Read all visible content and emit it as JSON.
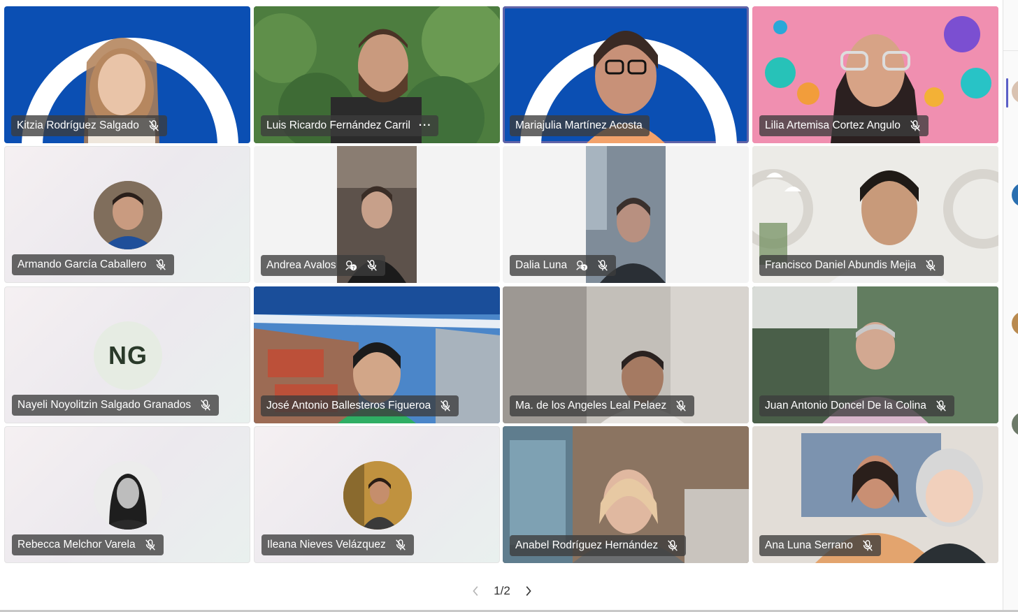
{
  "participants": [
    {
      "name": "Kitzia Rodríguez Salgado"
    },
    {
      "name": "Luis Ricardo Fernández Carril"
    },
    {
      "name": "Mariajulia Martínez Acosta"
    },
    {
      "name": "Lilia Artemisa Cortez Angulo"
    },
    {
      "name": "Armando García Caballero"
    },
    {
      "name": "Andrea Avalos"
    },
    {
      "name": "Dalia Luna"
    },
    {
      "name": "Francisco Daniel Abundis Mejia"
    },
    {
      "name": "Nayeli Noyolitzin Salgado Granados",
      "initials": "NG"
    },
    {
      "name": "José Antonio Ballesteros Figueroa"
    },
    {
      "name": "Ma. de los Angeles Leal Pelaez"
    },
    {
      "name": "Juan Antonio Doncel De la Colina"
    },
    {
      "name": "Rebecca Melchor Varela"
    },
    {
      "name": "Ileana Nieves Velázquez"
    },
    {
      "name": "Anabel Rodríguez Hernández"
    },
    {
      "name": "Ana Luna Serrano"
    }
  ],
  "more_options_label": "···",
  "pagination": {
    "label": "1/2"
  },
  "colors": {
    "accent": "#6264a7",
    "brand_blue": "#0b4fb3",
    "namebar": "#3c3c3c"
  },
  "icons": {
    "mic_off": "mic-off-icon",
    "unknown_status": "help-badge-icon",
    "prev": "chevron-left-icon",
    "next": "chevron-right-icon"
  }
}
